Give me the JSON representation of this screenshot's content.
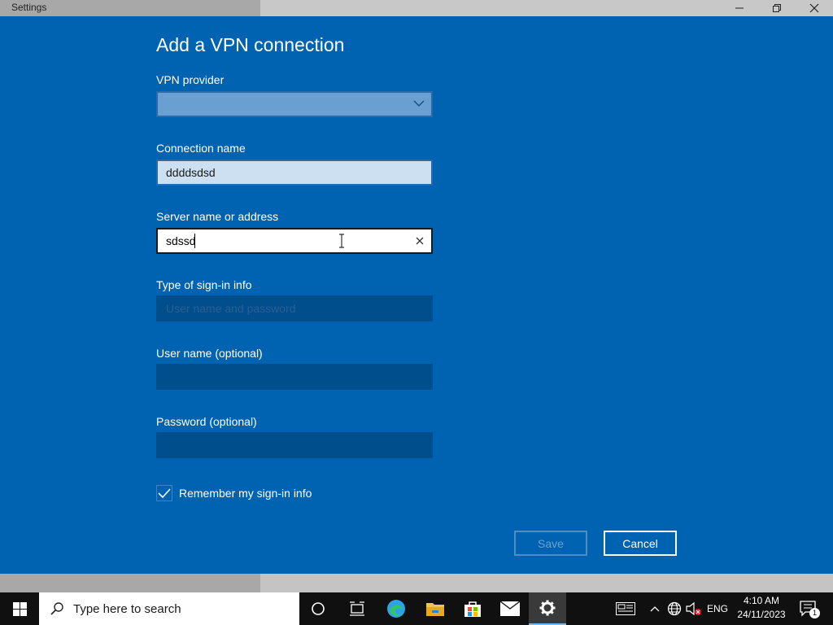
{
  "window": {
    "title": "Settings"
  },
  "dialog": {
    "title": "Add a VPN connection",
    "vpn_provider": {
      "label": "VPN provider",
      "value": ""
    },
    "connection_name": {
      "label": "Connection name",
      "value": "ddddsdsd"
    },
    "server": {
      "label": "Server name or address",
      "value": "sdssd"
    },
    "sign_in_type": {
      "label": "Type of sign-in info",
      "value": "User name and password"
    },
    "username": {
      "label": "User name (optional)",
      "value": ""
    },
    "password": {
      "label": "Password (optional)",
      "value": ""
    },
    "remember": {
      "label": "Remember my sign-in info",
      "checked": true
    },
    "save_label": "Save",
    "cancel_label": "Cancel"
  },
  "taskbar": {
    "search_placeholder": "Type here to search",
    "language": "ENG",
    "time": "4:10 AM",
    "date": "24/11/2023",
    "notification_count": "1"
  },
  "colors": {
    "accent": "#0063b1",
    "taskbar": "#101010"
  }
}
